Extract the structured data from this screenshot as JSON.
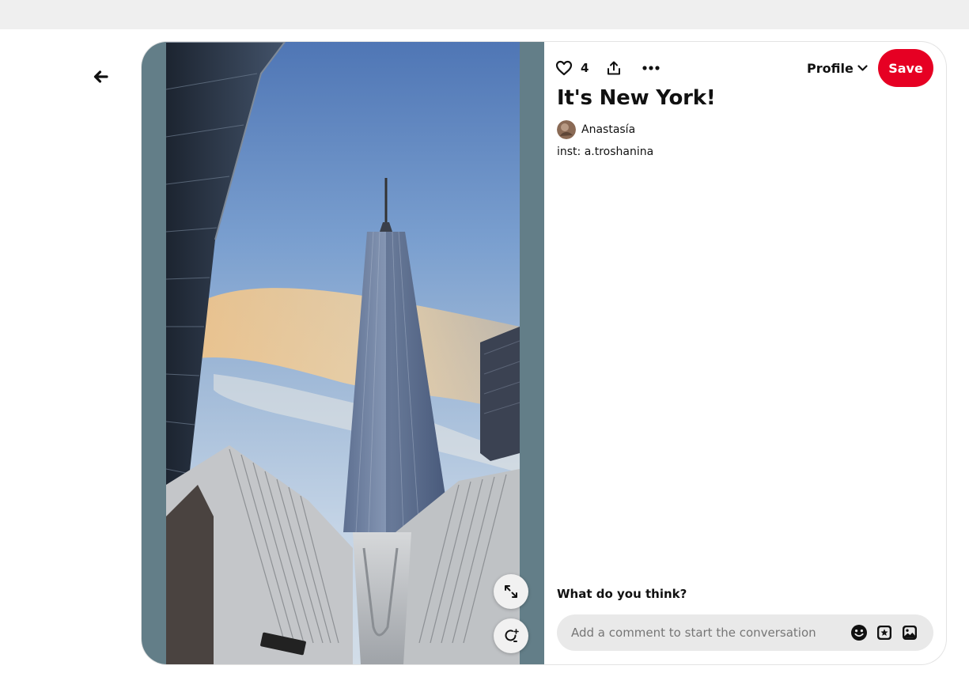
{
  "pin": {
    "title": "It's New York!",
    "like_count": "4",
    "author": {
      "name": "Anastasía"
    },
    "description": "inst: a.troshanina"
  },
  "header": {
    "profile_label": "Profile",
    "save_label": "Save"
  },
  "comments": {
    "heading": "What do you think?",
    "input_placeholder": "Add a comment to start the conversation"
  },
  "colors": {
    "save_button": "#e60023",
    "media_background": "#637e88",
    "comment_box": "#e9e9e9"
  },
  "icons": {
    "back": "arrow-left-icon",
    "like": "heart-icon",
    "share": "share-icon",
    "more": "ellipsis-icon",
    "profile_dropdown": "chevron-down-icon",
    "expand": "expand-icon",
    "visual_search": "lens-search-icon",
    "emoji": "smiley-icon",
    "sticker": "sticker-icon",
    "image": "image-icon"
  }
}
